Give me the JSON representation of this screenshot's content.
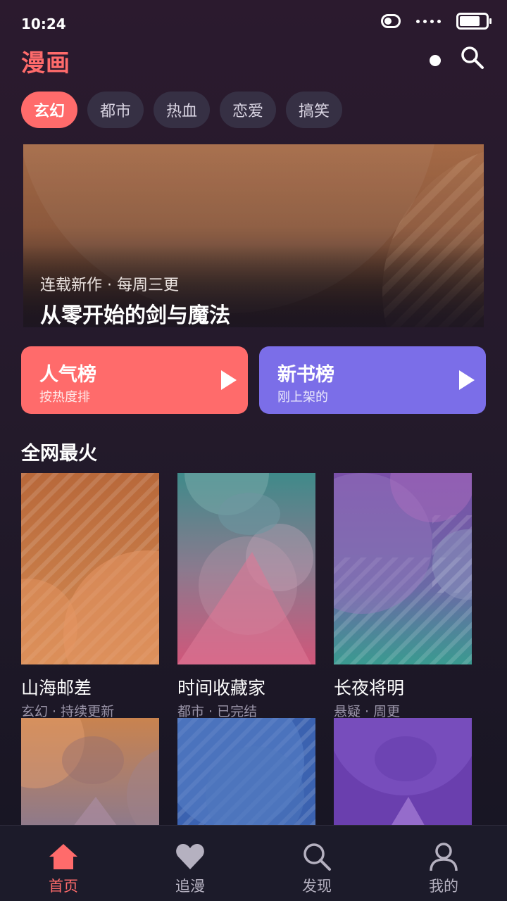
{
  "status_bar": {
    "time": "10:24"
  },
  "header": {
    "title": "漫画"
  },
  "categories": [
    {
      "label": "玄幻",
      "active": true
    },
    {
      "label": "都市",
      "active": false
    },
    {
      "label": "热血",
      "active": false
    },
    {
      "label": "恋爱",
      "active": false
    },
    {
      "label": "搞笑",
      "active": false
    }
  ],
  "banner": {
    "subtitle": "连载新作 · 每周三更",
    "title": "从零开始的剑与魔法"
  },
  "rankings": [
    {
      "title": "人气榜",
      "subtitle": "按热度排",
      "color": "#ff6b6b"
    },
    {
      "title": "新书榜",
      "subtitle": "刚上架的",
      "color": "#7b6ee8"
    }
  ],
  "section": {
    "title": "全网最火"
  },
  "books": [
    {
      "title": "山海邮差",
      "meta": "玄幻 · 持续更新"
    },
    {
      "title": "时间收藏家",
      "meta": "都市 · 已完结"
    },
    {
      "title": "长夜将明",
      "meta": "悬疑 · 周更"
    }
  ],
  "tabbar": [
    {
      "label": "首页",
      "icon": "home-icon",
      "active": true
    },
    {
      "label": "追漫",
      "icon": "heart-icon",
      "active": false
    },
    {
      "label": "发现",
      "icon": "search-icon",
      "active": false
    },
    {
      "label": "我的",
      "icon": "user-icon",
      "active": false
    }
  ],
  "colors": {
    "accent": "#ff6b6b",
    "purple": "#7b6ee8",
    "chip_bg": "#363044"
  }
}
